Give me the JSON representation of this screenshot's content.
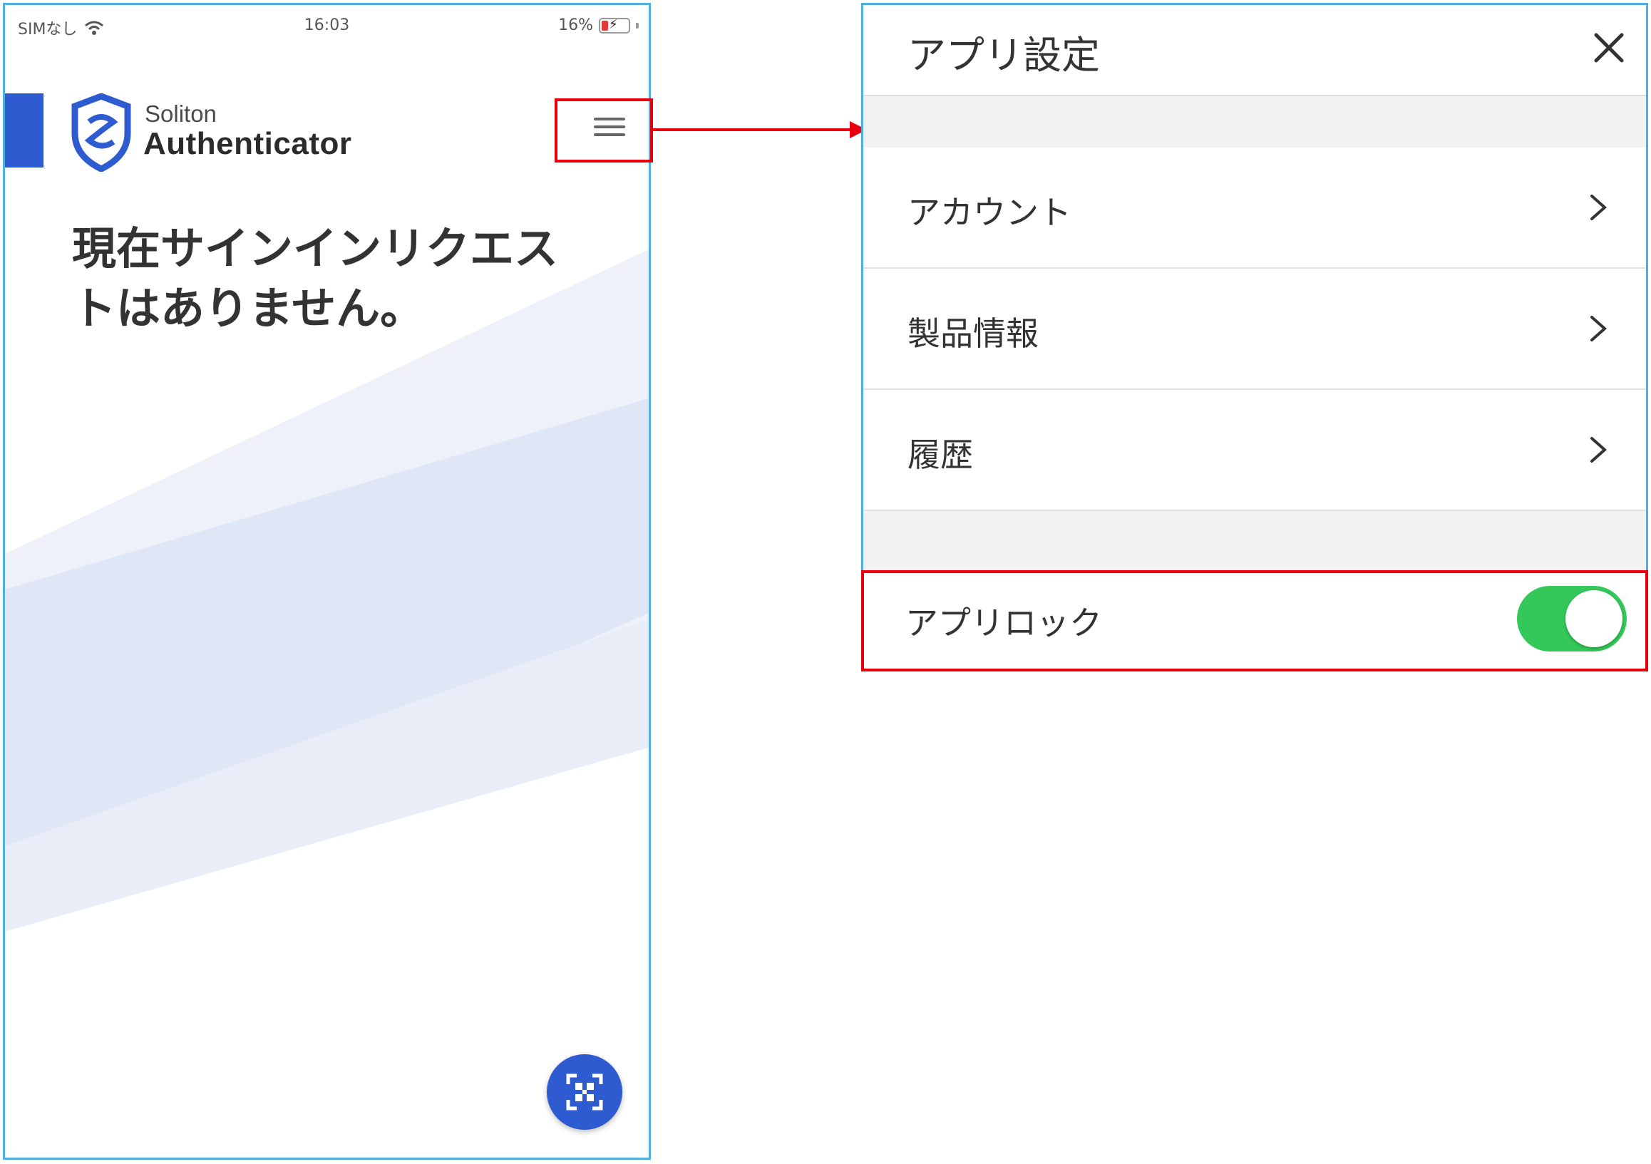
{
  "status_bar": {
    "carrier": "SIMなし",
    "time": "16:03",
    "battery": "16%"
  },
  "brand": {
    "sub": "Soliton",
    "main": "Authenticator",
    "accent_color": "#2f5bd0"
  },
  "main": {
    "empty_message": "現在サインインリクエストはありません。"
  },
  "settings": {
    "title": "アプリ設定",
    "items": [
      {
        "label": "アカウント"
      },
      {
        "label": "製品情報"
      },
      {
        "label": "履歴"
      }
    ],
    "app_lock": {
      "label": "アプリロック",
      "enabled": true,
      "toggle_color": "#34c759"
    }
  },
  "annotation": {
    "highlight_color": "#e8000f"
  },
  "icons": [
    "wifi-icon",
    "battery-icon",
    "shield-logo-icon",
    "hamburger-menu-icon",
    "close-icon",
    "chevron-right-icon",
    "qr-scan-icon"
  ]
}
